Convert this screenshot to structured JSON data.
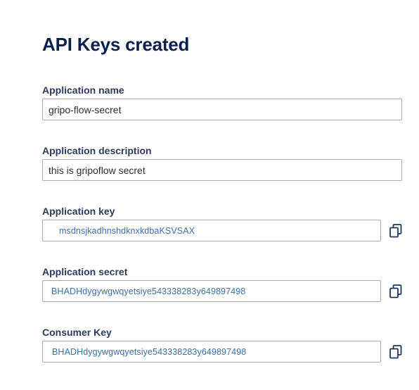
{
  "page": {
    "title": "API Keys created"
  },
  "fields": {
    "app_name": {
      "label": "Application name",
      "value": "gripo-flow-secret"
    },
    "app_description": {
      "label": "Application description",
      "value": "this is gripoflow secret"
    },
    "app_key": {
      "label": "Application key",
      "value": "msdnsjkadhnshdknxkdbaKSVSAX",
      "copy_icon": "copy-icon"
    },
    "app_secret": {
      "label": "Application secret",
      "value": "BHADHdygywgwqyetsiye543338283y649897498",
      "copy_icon": "copy-icon"
    },
    "consumer_key": {
      "label": "Consumer Key",
      "value": "BHADHdygywgwqyetsiye543338283y649897498",
      "copy_icon": "copy-icon"
    }
  },
  "colors": {
    "title": "#0b1f4d",
    "label": "#2e3a5c",
    "key_text": "#3d6fa8",
    "border": "#a8adb8"
  }
}
